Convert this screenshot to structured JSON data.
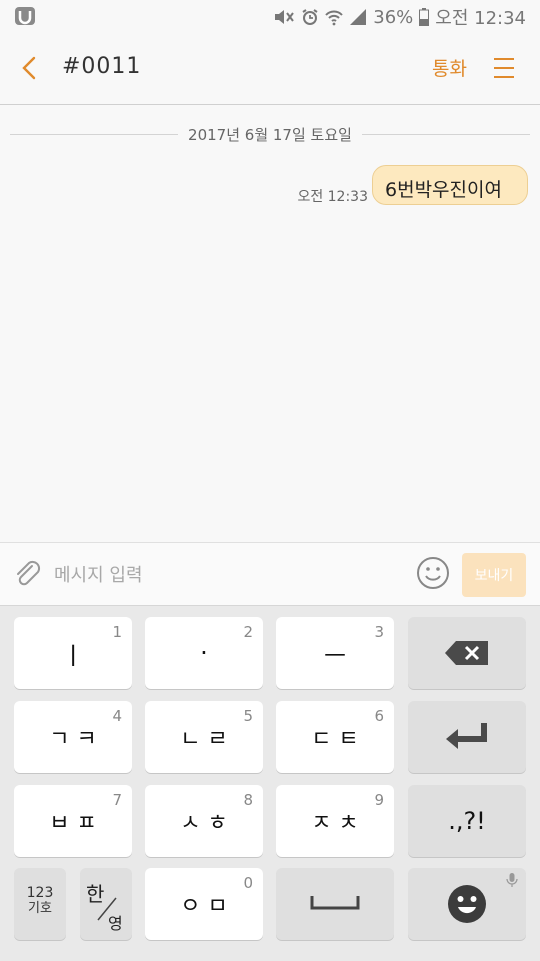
{
  "status_bar": {
    "battery": "36%",
    "time": "오전 12:34",
    "icons": [
      "app-icon",
      "mute-icon",
      "alarm-icon",
      "wifi-icon",
      "signal-icon",
      "battery-icon"
    ]
  },
  "header": {
    "title": "#0011",
    "call_label": "통화"
  },
  "conversation": {
    "date": "2017년 6월 17일 토요일",
    "messages": [
      {
        "time": "오전 12:33",
        "text": "6번박우진이여"
      }
    ]
  },
  "input": {
    "placeholder": "메시지 입력",
    "send_label": "보내기"
  },
  "keyboard": {
    "rows": [
      [
        {
          "label": "ㅣ",
          "num": "1"
        },
        {
          "label": "·",
          "num": "2"
        },
        {
          "label": "ㅡ",
          "num": "3"
        },
        {
          "label": "⌫",
          "num": ""
        }
      ],
      [
        {
          "label": "ㄱ ㅋ",
          "num": "4"
        },
        {
          "label": "ㄴ ㄹ",
          "num": "5"
        },
        {
          "label": "ㄷ ㅌ",
          "num": "6"
        },
        {
          "label": "↵",
          "num": ""
        }
      ],
      [
        {
          "label": "ㅂ ㅍ",
          "num": "7"
        },
        {
          "label": "ㅅ ㅎ",
          "num": "8"
        },
        {
          "label": "ㅈ ㅊ",
          "num": "9"
        },
        {
          "label": ".,?!",
          "num": ""
        }
      ]
    ],
    "bottom": {
      "sym_top": "123",
      "sym_bottom": "기호",
      "lang_top": "한",
      "lang_bottom": "영",
      "zero_label": "ㅇ ㅁ",
      "zero_num": "0"
    }
  },
  "colors": {
    "accent": "#e08a2c",
    "bubble": "#fde9bf",
    "send_disabled": "#fbe2bd"
  }
}
